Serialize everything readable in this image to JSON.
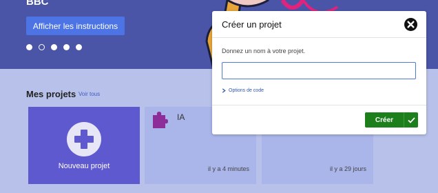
{
  "hero": {
    "title": "BBC",
    "instructions_button": "Afficher les instructions",
    "carousel_dots": 5,
    "active_dot_index": 1
  },
  "projects": {
    "title": "Mes projets",
    "see_all": "Voir tous",
    "new_project_label": "Nouveau projet",
    "cards": [
      {
        "name": "IA",
        "icon": "puzzle-icon",
        "time": "il y a 4 minutes"
      },
      {
        "name": "",
        "icon": "",
        "time": "il y a 29 jours"
      }
    ]
  },
  "modal": {
    "title": "Créer un projet",
    "prompt": "Donnez un nom à votre projet.",
    "input_value": "",
    "code_options": "Options de code",
    "create_button": "Créer",
    "close_icon": "close-icon",
    "accent": "#1c7f1c"
  }
}
